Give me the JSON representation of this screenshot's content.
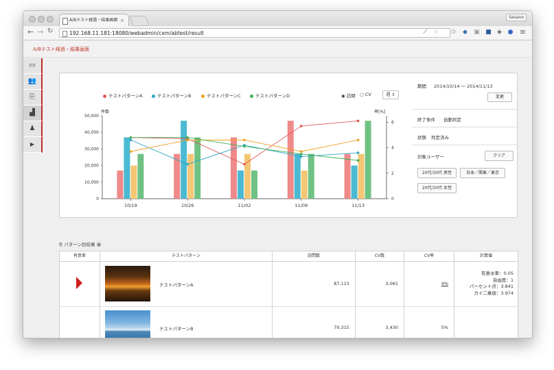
{
  "browser": {
    "tab_title": "A/Bテスト経過・結果画面",
    "tab_close": "×",
    "profile": "Sasano",
    "url": "192.168.11.181:18080/webadmin/cxm/abtest/result",
    "url_display": "192.168.11.181:18080/webadmin/cxm/abtest/result"
  },
  "app": {
    "title": "A/Bテスト経過・結果画面"
  },
  "chart_controls": {
    "radio_visits": "訪問",
    "radio_cv": "CV",
    "period_select": "週"
  },
  "chart_data": {
    "type": "bar",
    "categories": [
      "10/19",
      "10/26",
      "11/02",
      "11/09",
      "11/13"
    ],
    "left_axis_label": "件数",
    "right_axis_label": "率[%]",
    "left_ticks": [
      "50,000",
      "40,000",
      "30,000",
      "20,000",
      "10,000",
      "0"
    ],
    "right_ticks": [
      "6",
      "4",
      "2",
      "0"
    ],
    "ylim": [
      0,
      50000
    ],
    "y2lim": [
      0,
      6.5
    ],
    "series": [
      {
        "name": "テストパターンA",
        "color": "#e05656",
        "bar_color": "#ef8a8a",
        "values": [
          17000,
          27000,
          37000,
          47000,
          27000
        ],
        "rate": [
          4.8,
          4.7,
          2.7,
          5.7,
          6.1
        ]
      },
      {
        "name": "テストパターンB",
        "color": "#2aa6c4",
        "bar_color": "#4bb9d2",
        "values": [
          37000,
          47000,
          17000,
          27000,
          20000
        ],
        "rate": [
          4.6,
          2.7,
          4.2,
          3.3,
          3.6
        ]
      },
      {
        "name": "テストパターンC",
        "color": "#f0a020",
        "bar_color": "#f4c775",
        "values": [
          20000,
          27000,
          27000,
          17000,
          27000
        ],
        "rate": [
          3.7,
          4.6,
          4.6,
          3.7,
          4.6
        ]
      },
      {
        "name": "テストパターンD",
        "color": "#3fae55",
        "bar_color": "#6fc283",
        "values": [
          27000,
          37000,
          17000,
          27000,
          47000
        ],
        "rate": [
          4.8,
          4.8,
          4.1,
          3.5,
          3.0
        ]
      }
    ]
  },
  "right_panel": {
    "period_label": "期間",
    "period_value": "2014/10/14 ～ 2014/11/13",
    "change_button": "変更",
    "end_condition_label": "終了条件",
    "end_condition_value": "自動判定",
    "status_label": "状態",
    "status_value": "判定済み",
    "target_label": "対象ユーザー",
    "clear_button": "クリア",
    "segments": [
      "20代/30代 男性",
      "日本／関東／東京",
      "20代/30代 女性"
    ]
  },
  "results": {
    "section_title": "パターン別結果",
    "columns": [
      "有意差",
      "テストパターン",
      "訪問数",
      "CV数",
      "CV率",
      "計算値"
    ],
    "rows": [
      {
        "pattern": "テストパターンA",
        "visits": "87,115",
        "cv": "3,061",
        "cv_rate": "4%",
        "calc": [
          "有意水準：0.05",
          "自由度：1",
          "パーセント点：3.841",
          "カイ二乗値：3.974"
        ]
      },
      {
        "pattern": "テストパターンB",
        "visits": "70,315",
        "cv": "3,430",
        "cv_rate": "5%",
        "calc": []
      }
    ]
  }
}
